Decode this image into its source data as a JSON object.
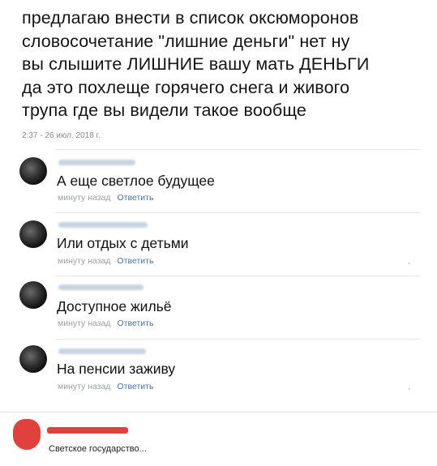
{
  "post": {
    "lines": [
      "предлагаю внести в список оксюморонов",
      "словосочетание \"лишние деньги\" нет ну",
      "вы слышите ЛИШНИЕ вашу мать ДЕНЬГИ",
      "да это похлеще горячего снега и живого",
      "трупа где вы видели такое вообще"
    ],
    "timestamp": "2:37 - 26 июл. 2018 г."
  },
  "comments": [
    {
      "text": "А еще светлое будущее",
      "time": "минуту назад",
      "reply": "Ответить"
    },
    {
      "text": "Или отдых с детьми",
      "time": "минуту назад",
      "reply": "Ответить"
    },
    {
      "text": "Доступное жильё",
      "time": "минуту назад",
      "reply": "Ответить"
    },
    {
      "text": "На пенсии заживу",
      "time": "минуту назад",
      "reply": "Ответить"
    }
  ],
  "footer": {
    "text": "Светское государство...",
    "avatar_color": "#e0413c"
  },
  "colors": {
    "link": "#4b73a4",
    "muted": "#9aa0a6"
  }
}
